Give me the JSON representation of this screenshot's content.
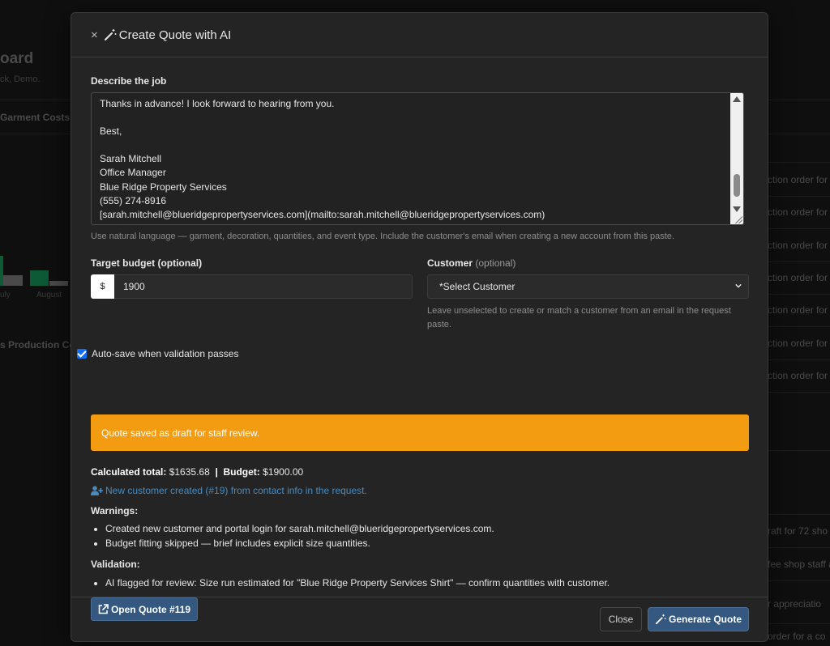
{
  "background": {
    "title": "oard",
    "subtitle": "ck, Demo.",
    "card1_title": "Garment Costs b",
    "months": [
      "uly",
      "August"
    ],
    "card2_title": "s Production Co",
    "right_rows": [
      "ction order for",
      "ction order for",
      "ction order for",
      "ction order for",
      "ction order for",
      "ction order for",
      "ction order for"
    ],
    "right_rows_lower": [
      "raft for 72 sho",
      "fee shop staff a",
      "r appreciatio",
      "order for a co"
    ]
  },
  "modal": {
    "title": "Create Quote with AI",
    "close_glyph": "×",
    "job_label": "Describe the job",
    "job_text": "Thanks in advance! I look forward to hearing from you.\n\nBest,\n\nSarah Mitchell\nOffice Manager\nBlue Ridge Property Services\n(555) 274-8916\n[sarah.mitchell@blueridgepropertyservices.com](mailto:sarah.mitchell@blueridgepropertyservices.com)",
    "job_help": "Use natural language — garment, decoration, quantities, and event type. Include the customer's email when creating a new account from this paste.",
    "budget_label": "Target budget (optional)",
    "budget_prefix": "$",
    "budget_value": "1900",
    "customer_label": "Customer",
    "customer_optional": "(optional)",
    "customer_selected": "*Select Customer",
    "customer_help": "Leave unselected to create or match a customer from an email in the request paste.",
    "autosave_label": "Auto-save when validation passes",
    "alert_text": "Quote saved as draft for staff review.",
    "calc_total_label": "Calculated total:",
    "calc_total_value": "$1635.68",
    "calc_sep": "|",
    "budget_result_label": "Budget:",
    "budget_result_value": "$1900.00",
    "new_customer_text": "New customer created (#19) from contact info in the request.",
    "warnings_title": "Warnings:",
    "warnings": [
      "Created new customer and portal login for sarah.mitchell@blueridgepropertyservices.com.",
      "Budget fitting skipped — brief includes explicit size quantities."
    ],
    "validation_title": "Validation:",
    "validation": [
      "AI flagged for review: Size run estimated for \"Blue Ridge Property Services Shirt\" — confirm quantities with customer."
    ],
    "open_quote_label": "Open Quote #119",
    "close_button": "Close",
    "generate_button": "Generate Quote"
  },
  "colors": {
    "alert": "#f39c12",
    "primary_button": "#34587f",
    "link": "#4a8bbf",
    "checkbox": "#0d6efd"
  }
}
